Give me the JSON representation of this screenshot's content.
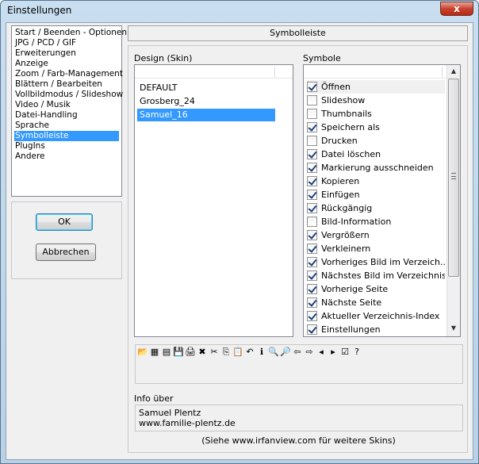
{
  "window": {
    "title": "Einstellungen",
    "close_glyph": "x"
  },
  "nav": {
    "items": [
      {
        "label": "Start / Beenden - Optionen",
        "selected": false
      },
      {
        "label": "JPG / PCD / GIF",
        "selected": false
      },
      {
        "label": "Erweiterungen",
        "selected": false
      },
      {
        "label": "Anzeige",
        "selected": false
      },
      {
        "label": "Zoom / Farb-Management",
        "selected": false
      },
      {
        "label": "Blättern / Bearbeiten",
        "selected": false
      },
      {
        "label": "Vollbildmodus / Slideshow",
        "selected": false
      },
      {
        "label": "Video / Musik",
        "selected": false
      },
      {
        "label": "Datei-Handling",
        "selected": false
      },
      {
        "label": "Sprache",
        "selected": false
      },
      {
        "label": "Symbolleiste",
        "selected": true
      },
      {
        "label": "PlugIns",
        "selected": false
      },
      {
        "label": "Andere",
        "selected": false
      }
    ]
  },
  "buttons": {
    "ok": "OK",
    "cancel": "Abbrechen"
  },
  "section_title": "Symbolleiste",
  "design": {
    "label": "Design (Skin)",
    "items": [
      {
        "label": "DEFAULT",
        "selected": false
      },
      {
        "label": "Grosberg_24",
        "selected": false
      },
      {
        "label": "Samuel_16",
        "selected": true
      }
    ]
  },
  "symbols": {
    "label": "Symbole",
    "items": [
      {
        "label": "Öffnen",
        "checked": true
      },
      {
        "label": "Slideshow",
        "checked": false
      },
      {
        "label": "Thumbnails",
        "checked": false
      },
      {
        "label": "Speichern als",
        "checked": true
      },
      {
        "label": "Drucken",
        "checked": false
      },
      {
        "label": "Datei löschen",
        "checked": true
      },
      {
        "label": "Markierung ausschneiden",
        "checked": true
      },
      {
        "label": "Kopieren",
        "checked": true
      },
      {
        "label": "Einfügen",
        "checked": true
      },
      {
        "label": "Rückgängig",
        "checked": true
      },
      {
        "label": "Bild-Information",
        "checked": false
      },
      {
        "label": "Vergrößern",
        "checked": true
      },
      {
        "label": "Verkleinern",
        "checked": true
      },
      {
        "label": "Vorheriges Bild im Verzeich...",
        "checked": true
      },
      {
        "label": "Nächstes Bild im Verzeichnis",
        "checked": true
      },
      {
        "label": "Vorherige Seite",
        "checked": true
      },
      {
        "label": "Nächste Seite",
        "checked": true
      },
      {
        "label": "Aktueller Verzeichnis-Index",
        "checked": true
      },
      {
        "label": "Einstellungen",
        "checked": true
      }
    ]
  },
  "toolbar_preview": {
    "icons": [
      {
        "name": "open-folder-icon",
        "glyph": "📂"
      },
      {
        "name": "slideshow-icon",
        "glyph": "▦"
      },
      {
        "name": "thumbnails-icon",
        "glyph": "▤"
      },
      {
        "name": "save-icon",
        "glyph": "💾"
      },
      {
        "name": "print-icon",
        "glyph": "🖨"
      },
      {
        "name": "delete-icon",
        "glyph": "✖"
      },
      {
        "name": "cut-icon",
        "glyph": "✂"
      },
      {
        "name": "copy-icon",
        "glyph": "⎘"
      },
      {
        "name": "paste-icon",
        "glyph": "📋"
      },
      {
        "name": "undo-icon",
        "glyph": "↶"
      },
      {
        "name": "info-icon",
        "glyph": "ℹ"
      },
      {
        "name": "zoom-in-icon",
        "glyph": "🔍"
      },
      {
        "name": "zoom-out-icon",
        "glyph": "🔎"
      },
      {
        "name": "prev-image-icon",
        "glyph": "⇦"
      },
      {
        "name": "next-image-icon",
        "glyph": "⇨"
      },
      {
        "name": "prev-page-icon",
        "glyph": "◂"
      },
      {
        "name": "next-page-icon",
        "glyph": "▸"
      },
      {
        "name": "folder-index-icon",
        "glyph": "☑"
      },
      {
        "name": "help-icon",
        "glyph": "?"
      }
    ]
  },
  "info": {
    "label": "Info über",
    "author": "Samuel Plentz",
    "url": "www.familie-plentz.de"
  },
  "footer": "(Siehe   www.irfanview.com   für weitere Skins)",
  "colors": {
    "selection": "#3399ff",
    "dialog_bg": "#f0f0f0",
    "title_gradient": "#c9dff0"
  }
}
